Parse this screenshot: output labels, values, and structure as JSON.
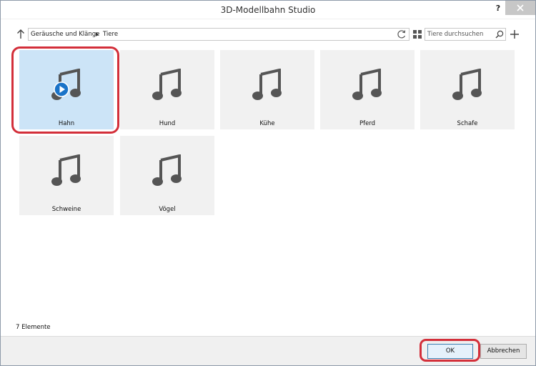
{
  "window": {
    "title": "3D-Modellbahn Studio",
    "help_label": "?"
  },
  "navigation": {
    "breadcrumbs": [
      "Geräusche und Klänge",
      "Tiere"
    ],
    "search_placeholder": "Tiere durchsuchen"
  },
  "icons": {
    "up": "arrow-up-icon",
    "refresh": "refresh-icon",
    "view": "grid-view-icon",
    "search": "magnifier-icon",
    "add": "plus-icon",
    "close": "close-icon",
    "item": "music-note-icon",
    "play": "play-icon"
  },
  "items": [
    {
      "label": "Hahn",
      "selected": true
    },
    {
      "label": "Hund",
      "selected": false
    },
    {
      "label": "Kühe",
      "selected": false
    },
    {
      "label": "Pferd",
      "selected": false
    },
    {
      "label": "Schafe",
      "selected": false
    },
    {
      "label": "Schweine",
      "selected": false
    },
    {
      "label": "Vögel",
      "selected": false
    }
  ],
  "status": {
    "count_text": "7 Elemente"
  },
  "buttons": {
    "ok": "OK",
    "cancel": "Abbrechen"
  },
  "colors": {
    "selection": "#cce4f7",
    "annotation": "#d32f3a",
    "note": "#555555",
    "play": "#1a73c8"
  }
}
